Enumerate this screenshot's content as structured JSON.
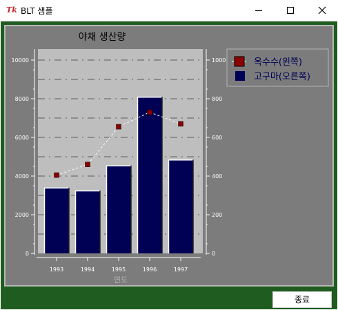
{
  "window": {
    "title": "BLT 샘플",
    "icon": "tk-feather-icon"
  },
  "chart_data": {
    "type": "bar",
    "title": "야채 생산량",
    "xlabel": "연도",
    "categories": [
      "1993",
      "1994",
      "1995",
      "1996",
      "1997"
    ],
    "series": [
      {
        "name": "옥수수(왼쪽)",
        "axis": "left",
        "kind": "line",
        "values": [
          4050,
          4600,
          6550,
          7300,
          6700
        ],
        "color": "#8b0000"
      },
      {
        "name": "고구마(오른쪽)",
        "axis": "right",
        "kind": "bar",
        "values": [
          340,
          325,
          455,
          810,
          485
        ],
        "color": "#000055"
      }
    ],
    "y_left": {
      "ylim": [
        0,
        10000
      ],
      "ticks": [
        "0",
        "2000",
        "4000",
        "6000",
        "8000",
        "10000"
      ]
    },
    "y_right": {
      "ylim": [
        0,
        1000
      ],
      "ticks": [
        "0",
        "200",
        "400",
        "600",
        "800",
        "1000"
      ]
    },
    "grid": true,
    "legend_position": "right"
  },
  "buttons": {
    "quit": "종료"
  }
}
